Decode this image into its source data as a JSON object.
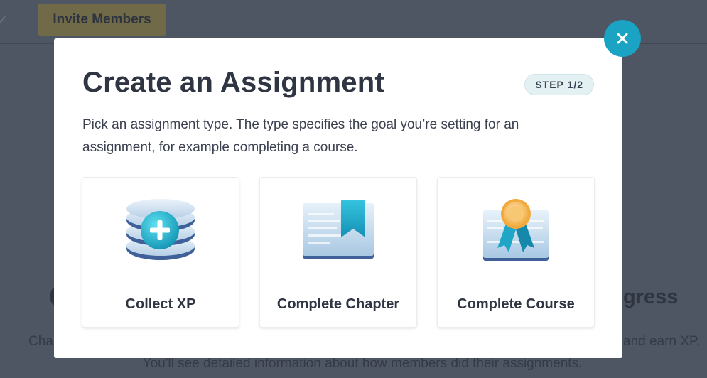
{
  "background": {
    "invite_button": "Invite Members",
    "heading_fragment": "gress",
    "text_left_fragment": "Cha",
    "text_right_fragment": "and earn XP.",
    "text_bottom": "You'll see detailed information about how members did their assignments."
  },
  "modal": {
    "title": "Create an Assignment",
    "step": "STEP 1/2",
    "description": "Pick an assignment type. The type specifies the goal you’re setting for an assignment, for example completing a course.",
    "cards": [
      {
        "label": "Collect XP",
        "icon": "xp-stack-icon"
      },
      {
        "label": "Complete Chapter",
        "icon": "chapter-book-icon"
      },
      {
        "label": "Complete Course",
        "icon": "course-certificate-icon"
      }
    ]
  },
  "colors": {
    "accent": "#1aa3c2",
    "title": "#2f3542",
    "badge_bg": "#e3f1f3",
    "overlay": "#4f5663"
  }
}
